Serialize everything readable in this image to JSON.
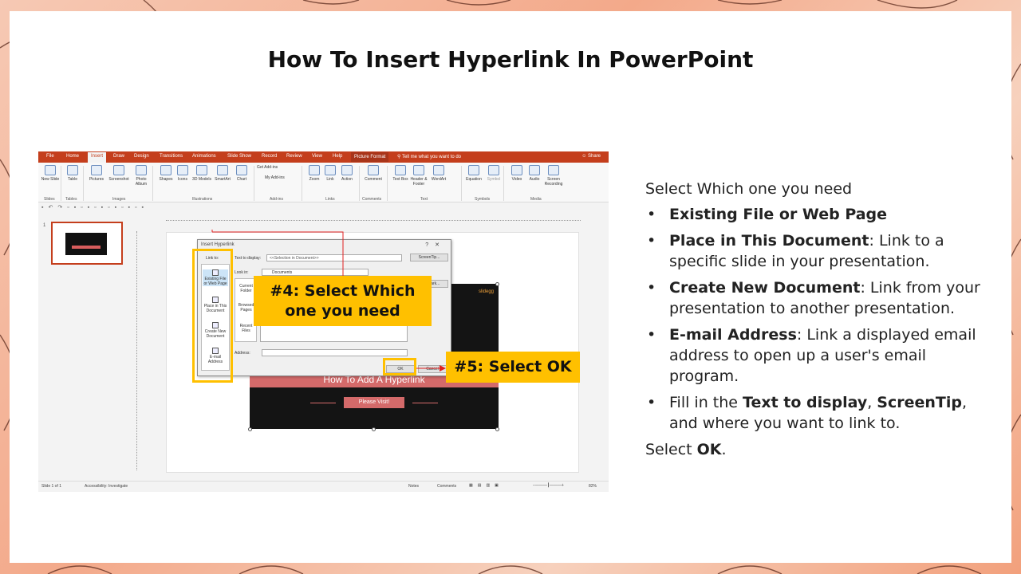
{
  "slide": {
    "title": "How To Insert Hyperlink In PowerPoint"
  },
  "powerpoint": {
    "tabs": [
      "File",
      "Home",
      "Insert",
      "Draw",
      "Design",
      "Transitions",
      "Animations",
      "Slide Show",
      "Record",
      "Review",
      "View",
      "Help",
      "Picture Format"
    ],
    "active_tab": "Insert",
    "tell_me": "Tell me what you want to do",
    "share": "Share",
    "ribbon_buttons": [
      "New Slide",
      "Table",
      "Pictures",
      "Screenshot",
      "Photo Album",
      "Shapes",
      "Icons",
      "3D Models",
      "SmartArt",
      "Chart",
      "Get Add-ins",
      "My Add-ins",
      "Zoom",
      "Link",
      "Action",
      "Comment",
      "Text Box",
      "Header & Footer",
      "WordArt",
      "Equation",
      "Symbol",
      "Video",
      "Audio",
      "Screen Recording"
    ],
    "ribbon_groups": [
      "Slides",
      "Tables",
      "Images",
      "Illustrations",
      "Add-ins",
      "Links",
      "Comments",
      "Text",
      "Symbols",
      "Media"
    ],
    "thumbnail_number": "1",
    "slide_content": {
      "brand": "slidegg",
      "heading": "How To Add A Hyperlink",
      "button": "Please Visit!"
    },
    "statusbar": {
      "slide": "Slide 1 of 1",
      "accessibility": "Accessibility: Investigate",
      "notes": "Notes",
      "comments": "Comments",
      "zoom": "82%"
    },
    "dialog": {
      "title": "Insert Hyperlink",
      "link_to_label": "Link to:",
      "link_to_items": [
        "Existing File or Web Page",
        "Place in This Document",
        "Create New Document",
        "E-mail Address"
      ],
      "text_to_display_label": "Text to display:",
      "text_to_display_value": "<<Selection in Document>>",
      "screentip_button": "ScreenTip...",
      "look_in_label": "Look in:",
      "look_in_value": "Documents",
      "bookmark_button": "Bookmark...",
      "nav_items": [
        "Current Folder",
        "Browsed Pages",
        "Recent Files"
      ],
      "address_label": "Address:",
      "ok_button": "OK",
      "cancel_button": "Cancel"
    }
  },
  "callouts": {
    "step4": "#4: Select Which one you need",
    "step5": "#5: Select OK"
  },
  "notes": {
    "intro": "Select Which one you need",
    "items": [
      {
        "bold": "Existing File or Web Page",
        "rest": ""
      },
      {
        "bold": "Place in This Document",
        "rest": ": Link to a specific slide in your presentation."
      },
      {
        "bold": "Create New Document",
        "rest": ": Link from your presentation to another presentation."
      },
      {
        "bold": "E-mail Address",
        "rest": ": Link a displayed email address to open up a user's email program."
      }
    ],
    "fill_in": {
      "pre": "Fill in the ",
      "b1": "Text to display",
      "sep": ", ",
      "b2": "ScreenTip",
      "post": ", and where you want to link to."
    },
    "outro": {
      "pre": "Select ",
      "bold": "OK",
      "post": "."
    }
  }
}
